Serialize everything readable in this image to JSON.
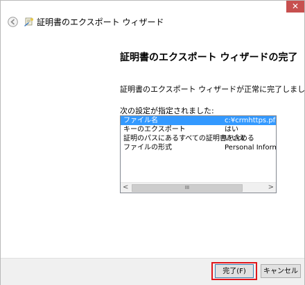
{
  "window": {
    "close_label": "✕",
    "title": "証明書のエクスポート ウィザード"
  },
  "main": {
    "heading": "証明書のエクスポート ウィザードの完了",
    "message": "証明書のエクスポート ウィザードが正常に完了しました。",
    "settings_label": "次の設定が指定されました:"
  },
  "settings": [
    {
      "name": "ファイル名",
      "value": "c:¥crmhttps.pfx",
      "selected": true
    },
    {
      "name": "キーのエクスポート",
      "value": "はい",
      "selected": false
    },
    {
      "name": "証明のパスにあるすべての証明書を含める",
      "value": "いいえ",
      "selected": false
    },
    {
      "name": "ファイルの形式",
      "value": "Personal Informa",
      "selected": false
    }
  ],
  "scrollbar": {
    "left_arrow": "<",
    "right_arrow": ">",
    "thumb_grip": "III"
  },
  "buttons": {
    "finish": "完了(F)",
    "cancel": "キャンセル"
  },
  "colors": {
    "selection": "#3399ff",
    "highlight": "#e0151b",
    "close": "#c7504f"
  }
}
